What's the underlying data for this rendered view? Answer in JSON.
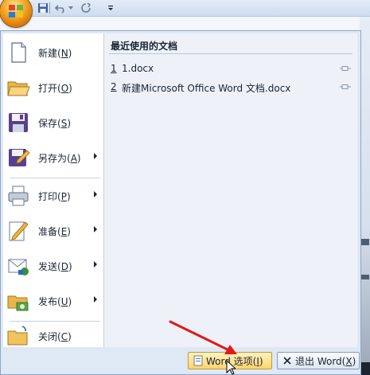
{
  "quick_access": {
    "icons": [
      "office-orb",
      "save-icon",
      "undo-icon",
      "redo-icon",
      "customize-dropdown-icon"
    ]
  },
  "menu": {
    "items": [
      {
        "name": "new",
        "label": "新建(N)",
        "key": "N",
        "prefix": "新建(",
        "suffix": ")",
        "icon": "new-document-icon",
        "has_submenu": false
      },
      {
        "name": "open",
        "label": "打开(O)",
        "prefix": "打开(",
        "key": "O",
        "suffix": ")",
        "icon": "open-folder-icon",
        "has_submenu": false
      },
      {
        "name": "save",
        "label": "保存(S)",
        "prefix": "保存(",
        "key": "S",
        "suffix": ")",
        "icon": "floppy-disk-icon",
        "has_submenu": false
      },
      {
        "name": "save-as",
        "label": "另存为(A)",
        "prefix": "另存为(",
        "key": "A",
        "suffix": ")",
        "icon": "save-as-icon",
        "has_submenu": true
      },
      {
        "name": "print",
        "label": "打印(P)",
        "prefix": "打印(",
        "key": "P",
        "suffix": ")",
        "icon": "printer-icon",
        "has_submenu": true
      },
      {
        "name": "prepare",
        "label": "准备(E)",
        "prefix": "准备(",
        "key": "E",
        "suffix": ")",
        "icon": "prepare-pencil-icon",
        "has_submenu": true
      },
      {
        "name": "send",
        "label": "发送(D)",
        "prefix": "发送(",
        "key": "D",
        "suffix": ")",
        "icon": "send-mail-icon",
        "has_submenu": true
      },
      {
        "name": "publish",
        "label": "发布(U)",
        "prefix": "发布(",
        "key": "U",
        "suffix": ")",
        "icon": "publish-folder-icon",
        "has_submenu": true
      },
      {
        "name": "close",
        "label": "关闭(C)",
        "prefix": "关闭(",
        "key": "C",
        "suffix": ")",
        "icon": "close-folder-icon",
        "has_submenu": false
      }
    ]
  },
  "recent": {
    "title": "最近使用的文档",
    "documents": [
      {
        "number": "1",
        "name": "1.docx"
      },
      {
        "number": "2",
        "name": "新建Microsoft Office Word 文档.docx"
      }
    ]
  },
  "buttons": {
    "options": {
      "prefix": "Word 选项(",
      "key": "I",
      "suffix": ")"
    },
    "exit": {
      "prefix": "退出 Word(",
      "key": "X",
      "suffix": ")"
    }
  },
  "colors": {
    "menu_background": "#dfe8f5",
    "annotation_arrow": "#e0191b",
    "options_button_highlight": "#ffd56a"
  }
}
